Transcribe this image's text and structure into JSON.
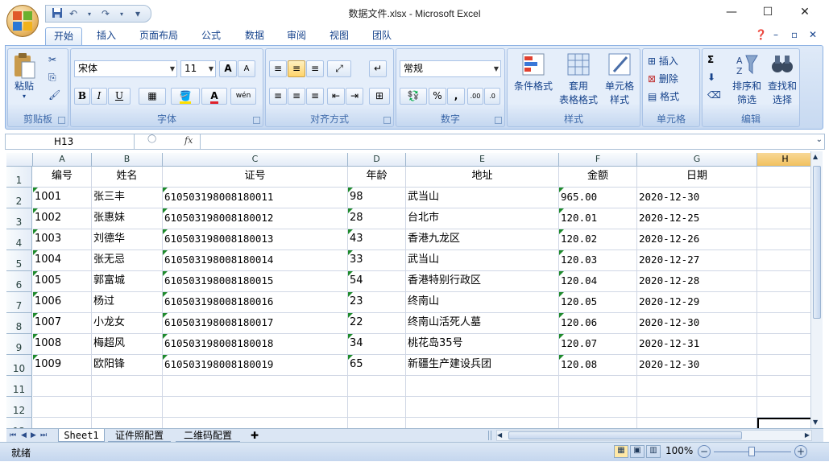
{
  "window": {
    "title": "数据文件.xlsx - Microsoft Excel",
    "minimize": "—",
    "maximize": "☐",
    "close": "✕"
  },
  "qat": {
    "save_icon": "save-icon",
    "undo": "↶",
    "redo": "↷",
    "customize": "▾"
  },
  "tabs": [
    {
      "label": "开始"
    },
    {
      "label": "插入"
    },
    {
      "label": "页面布局"
    },
    {
      "label": "公式"
    },
    {
      "label": "数据"
    },
    {
      "label": "审阅"
    },
    {
      "label": "视图"
    },
    {
      "label": "团队"
    }
  ],
  "ribbon": {
    "clipboard": {
      "label": "剪贴板",
      "paste": "粘贴"
    },
    "font": {
      "label": "字体",
      "name": "宋体",
      "size": "11",
      "bold": "B",
      "italic": "I",
      "underline": "U",
      "grow": "A",
      "shrink": "A",
      "phonetic": "wén",
      "font_color_letter": "A"
    },
    "alignment": {
      "label": "对齐方式"
    },
    "number": {
      "label": "数字",
      "format": "常规",
      "percent": "%",
      "comma": ",",
      "inc_decimal": ".00",
      "dec_decimal": ".0"
    },
    "styles": {
      "label": "样式",
      "conditional": "条件格式",
      "table_format_1": "套用",
      "table_format_2": "表格格式",
      "cell_style_1": "单元格",
      "cell_style_2": "样式"
    },
    "cells": {
      "label": "单元格",
      "insert": "插入",
      "delete": "删除",
      "format": "格式"
    },
    "editing": {
      "label": "编辑",
      "sigma": "Σ",
      "sort_1": "排序和",
      "sort_2": "筛选",
      "find_1": "查找和",
      "find_2": "选择"
    }
  },
  "formula_bar": {
    "name_box": "H13",
    "fx": "fx",
    "content": ""
  },
  "columns": [
    "A",
    "B",
    "C",
    "D",
    "E",
    "F",
    "G",
    "H"
  ],
  "rows": [
    [
      "编号",
      "姓名",
      "证号",
      "年龄",
      "地址",
      "金额",
      "日期",
      ""
    ],
    [
      "1001",
      "张三丰",
      "610503198008180011",
      "98",
      "武当山",
      "965.00",
      "2020-12-30",
      ""
    ],
    [
      "1002",
      "张惠妹",
      "610503198008180012",
      "28",
      "台北市",
      "120.01",
      "2020-12-25",
      ""
    ],
    [
      "1003",
      "刘德华",
      "610503198008180013",
      "43",
      "香港九龙区",
      "120.02",
      "2020-12-26",
      ""
    ],
    [
      "1004",
      "张无忌",
      "610503198008180014",
      "33",
      "武当山",
      "120.03",
      "2020-12-27",
      ""
    ],
    [
      "1005",
      "郭富城",
      "610503198008180015",
      "54",
      "香港特别行政区",
      "120.04",
      "2020-12-28",
      ""
    ],
    [
      "1006",
      "杨过",
      "610503198008180016",
      "23",
      "终南山",
      "120.05",
      "2020-12-29",
      ""
    ],
    [
      "1007",
      "小龙女",
      "610503198008180017",
      "22",
      "终南山活死人墓",
      "120.06",
      "2020-12-30",
      ""
    ],
    [
      "1008",
      "梅超风",
      "610503198008180018",
      "34",
      "桃花岛35号",
      "120.07",
      "2020-12-31",
      ""
    ],
    [
      "1009",
      "欧阳锋",
      "610503198008180019",
      "65",
      "新疆生产建设兵团",
      "120.08",
      "2020-12-30",
      ""
    ],
    [
      "",
      "",
      "",
      "",
      "",
      "",
      "",
      ""
    ],
    [
      "",
      "",
      "",
      "",
      "",
      "",
      "",
      ""
    ],
    [
      "",
      "",
      "",
      "",
      "",
      "",
      "",
      ""
    ]
  ],
  "row_numbers": [
    "1",
    "2",
    "3",
    "4",
    "5",
    "6",
    "7",
    "8",
    "9",
    "10",
    "11",
    "12",
    "13"
  ],
  "sheet_tabs": [
    {
      "label": "Sheet1"
    },
    {
      "label": "证件照配置"
    },
    {
      "label": "二维码配置"
    }
  ],
  "status": {
    "ready": "就绪",
    "zoom": "100%",
    "zoom_out": "−",
    "zoom_in": "+"
  },
  "colors": {
    "selected_header": "#f1c15f",
    "ribbon_bg": "#c7d9f1",
    "text_indicator": "#1e8a2c"
  }
}
